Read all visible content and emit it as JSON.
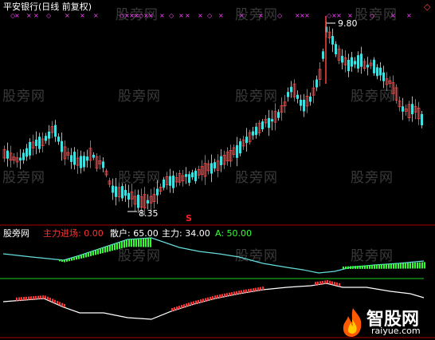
{
  "header": {
    "title": "平安银行(日线 前复权)"
  },
  "price_chart": {
    "high_label": "9.80",
    "low_label": "8.35",
    "signal_glyph": "S",
    "right_marker": "◇"
  },
  "indicator": {
    "name": "股旁网",
    "items": [
      {
        "label": "主力进场:",
        "value": "0.00",
        "color": "#ff3333"
      },
      {
        "label": "散户:",
        "value": "65.00",
        "color": "#ffffff"
      },
      {
        "label": "主力:",
        "value": "34.00",
        "color": "#ffffff"
      },
      {
        "label": "A:",
        "value": "50.00",
        "color": "#33ff33"
      }
    ]
  },
  "watermarks": [
    "股旁网",
    "股旁网",
    "股旁网",
    "股旁网",
    "股旁网",
    "股旁网",
    "股旁网",
    "股旁网",
    "股旁网",
    "股旁网",
    "股旁网",
    "股旁网",
    "股旁网",
    "股旁网"
  ],
  "logo": {
    "cn": "智股网",
    "url": "raiyue.com"
  },
  "colors": {
    "up": "#ff4040",
    "down": "#40e0e0",
    "ma_white": "#ffffff",
    "green_fill": "#33ff33",
    "red_fill": "#ff3333",
    "magenta_marks": "#ff44ff",
    "separator": "#aa0000"
  }
}
